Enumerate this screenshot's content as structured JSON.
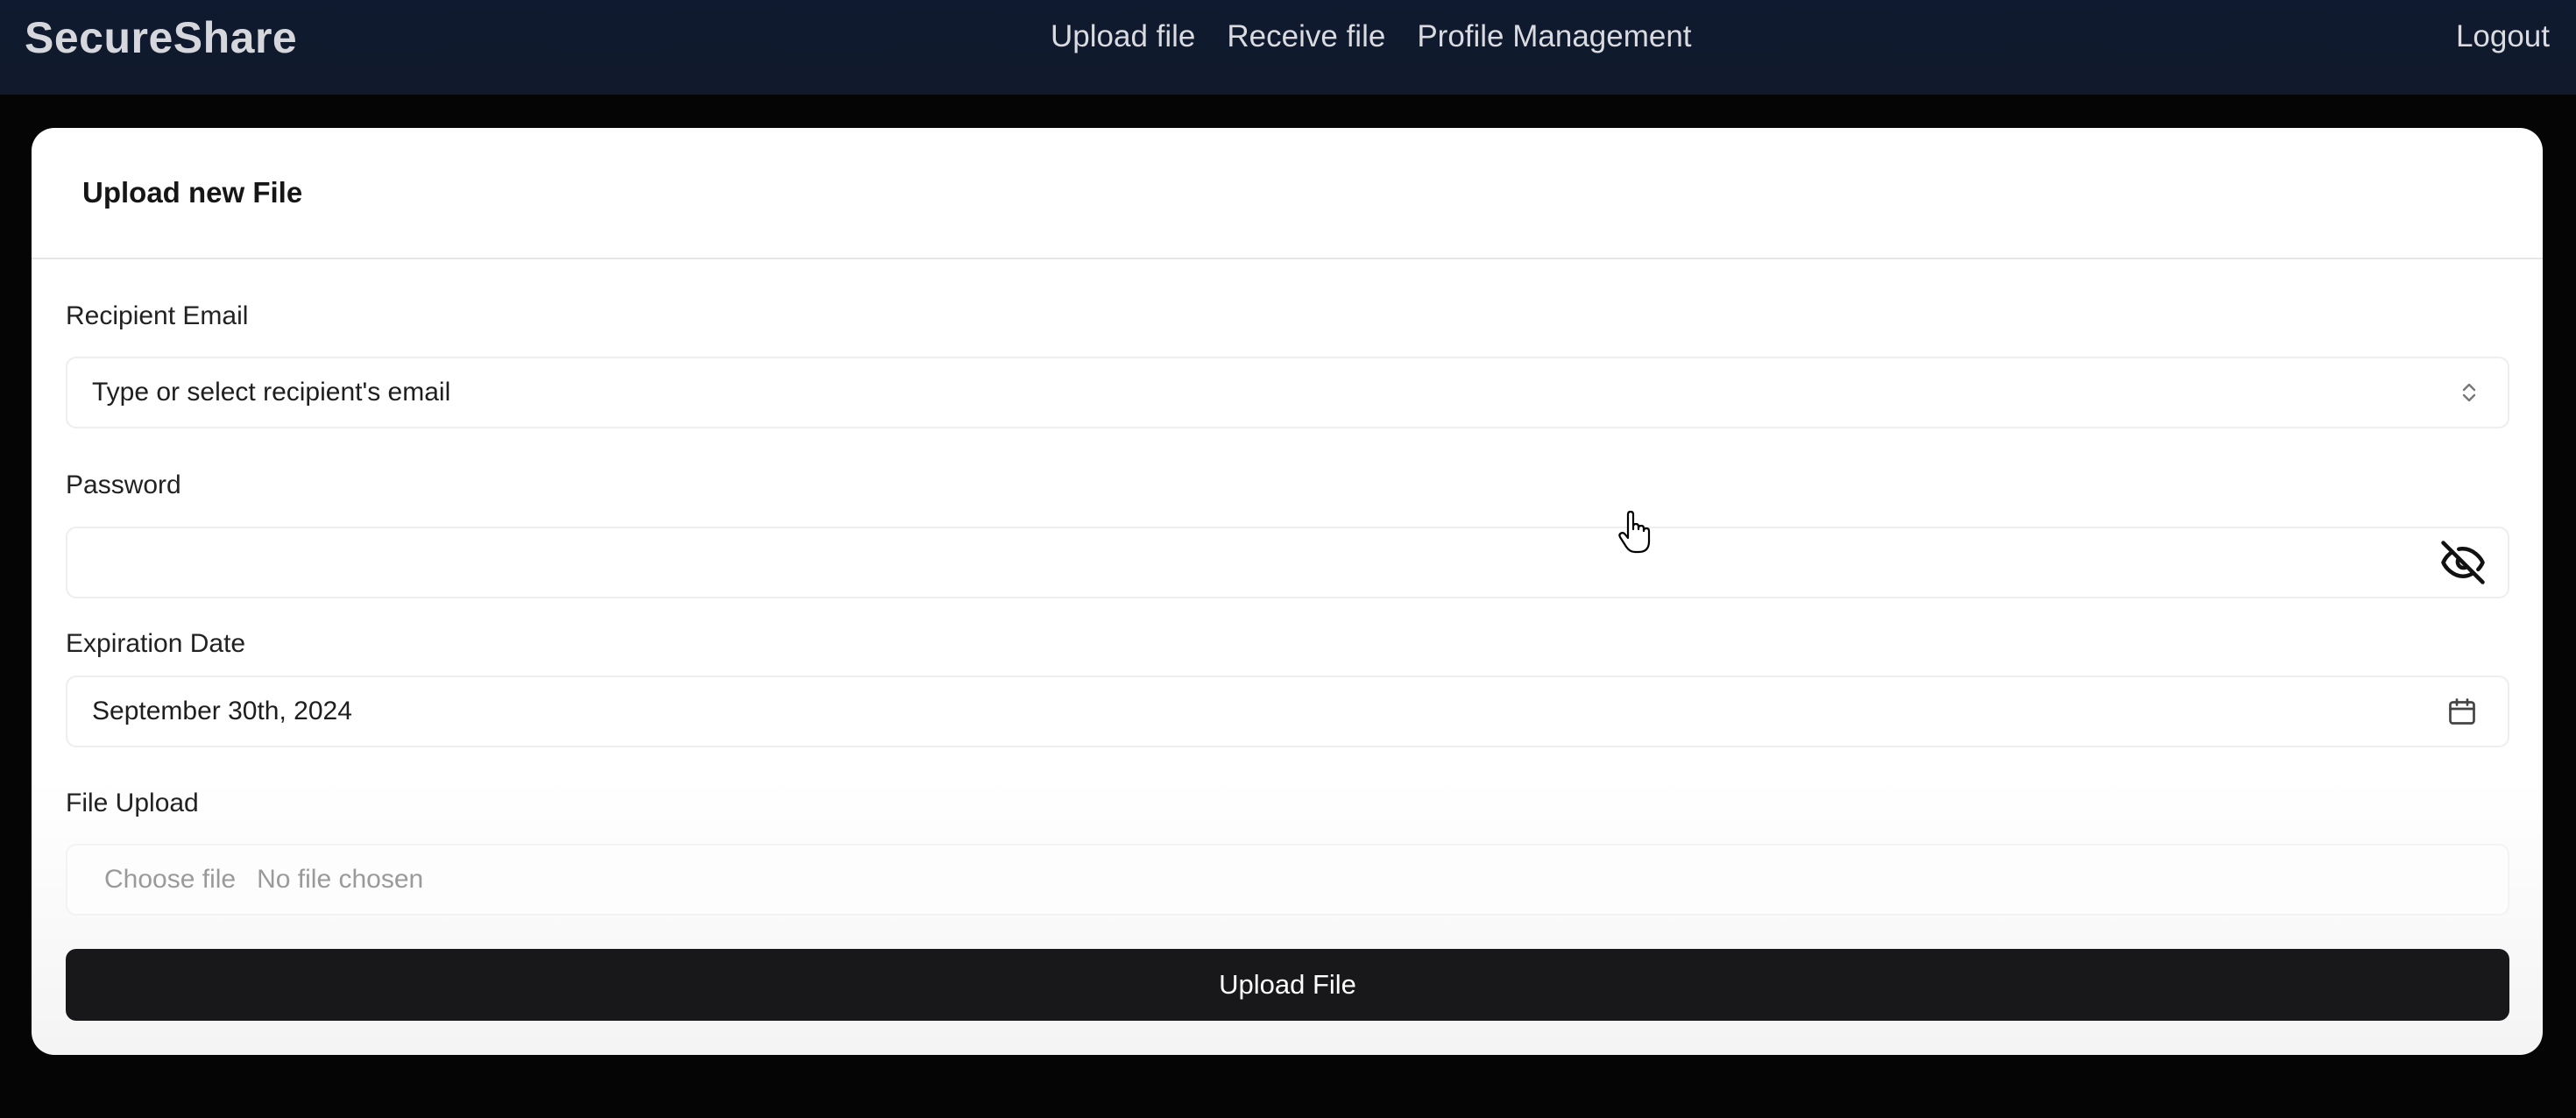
{
  "header": {
    "brand": "SecureShare",
    "nav": [
      {
        "label": "Upload file"
      },
      {
        "label": "Receive file"
      },
      {
        "label": "Profile Management"
      }
    ],
    "logout_label": "Logout"
  },
  "form": {
    "title": "Upload new File",
    "recipient": {
      "label": "Recipient Email",
      "placeholder": "Type or select recipient's email",
      "icon": "chevron-up-down-icon"
    },
    "password": {
      "label": "Password",
      "value": "",
      "icon": "eye-off-icon"
    },
    "expiration": {
      "label": "Expiration Date",
      "value": "September 30th, 2024",
      "icon": "calendar-icon"
    },
    "file_upload": {
      "label": "File Upload",
      "button_label": "Choose file",
      "status": "No file chosen"
    },
    "submit_label": "Upload File"
  },
  "colors": {
    "topbar": "#111a2b",
    "background": "#050505",
    "card": "#ffffff",
    "button": "#18181b"
  }
}
